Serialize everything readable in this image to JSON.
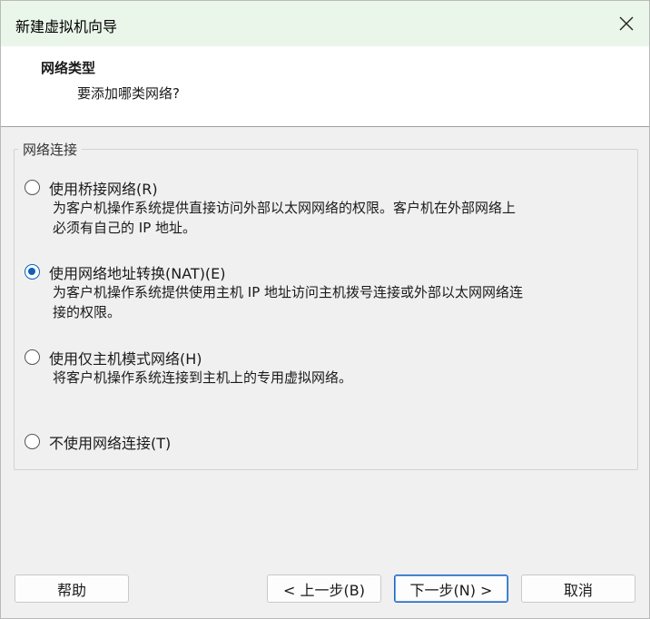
{
  "window": {
    "title": "新建虚拟机向导"
  },
  "header": {
    "title": "网络类型",
    "subtitle": "要添加哪类网络?"
  },
  "network_group": {
    "label": "网络连接",
    "options": [
      {
        "label": "使用桥接网络(R)",
        "description_lines": [
          "为客户机操作系统提供直接访问外部以太网网络的权限。客户机在外部网络上",
          "必须有自己的 IP 地址。"
        ],
        "checked": false
      },
      {
        "label": "使用网络地址转换(NAT)(E)",
        "description_lines": [
          "为客户机操作系统提供使用主机 IP 地址访问主机拨号连接或外部以太网网络连",
          "接的权限。"
        ],
        "checked": true
      },
      {
        "label": "使用仅主机模式网络(H)",
        "description_lines": [
          "将客户机操作系统连接到主机上的专用虚拟网络。"
        ],
        "checked": false
      },
      {
        "label": "不使用网络连接(T)",
        "description_lines": [],
        "checked": false
      }
    ]
  },
  "buttons": {
    "help": "帮助",
    "back": "< 上一步(B)",
    "next": "下一步(N) >",
    "cancel": "取消"
  },
  "colors": {
    "titlebar_bg": "#e9f6e9",
    "accent": "#0a5fbf"
  },
  "icons": {
    "close": "close-icon"
  }
}
